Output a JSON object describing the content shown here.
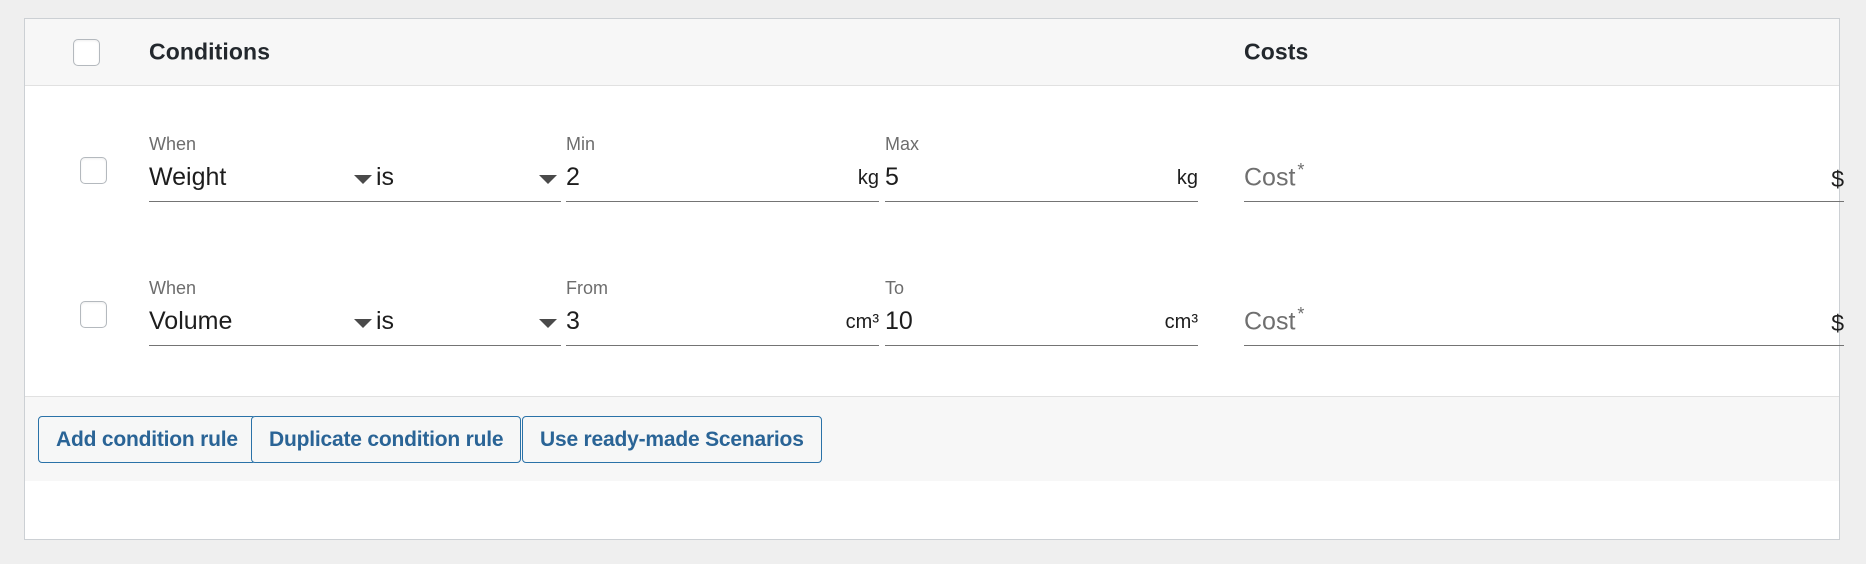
{
  "header": {
    "conditions_label": "Conditions",
    "costs_label": "Costs"
  },
  "rows": [
    {
      "when_label": "When",
      "property": "Weight",
      "operator": "is",
      "min_label": "Min",
      "min_value": "2",
      "min_unit": "kg",
      "max_label": "Max",
      "max_value": "5",
      "max_unit": "kg",
      "cost_placeholder": "Cost",
      "cost_required_marker": "*",
      "cost_unit": "$"
    },
    {
      "when_label": "When",
      "property": "Volume",
      "operator": "is",
      "min_label": "From",
      "min_value": "3",
      "min_unit": "cm³",
      "max_label": "To",
      "max_value": "10",
      "max_unit": "cm³",
      "cost_placeholder": "Cost",
      "cost_required_marker": "*",
      "cost_unit": "$"
    }
  ],
  "footer": {
    "add_rule_label": "Add condition rule",
    "duplicate_rule_label": "Duplicate condition rule",
    "scenarios_label": "Use ready-made Scenarios"
  },
  "colors": {
    "page_background": "#efefef",
    "panel_background": "#ffffff",
    "header_background": "#f7f7f7",
    "border": "#ccd0d4",
    "text": "#1d1d1d",
    "muted_text": "#6d6d6d",
    "button_text": "#2a6496",
    "button_border": "#2a72a8"
  }
}
